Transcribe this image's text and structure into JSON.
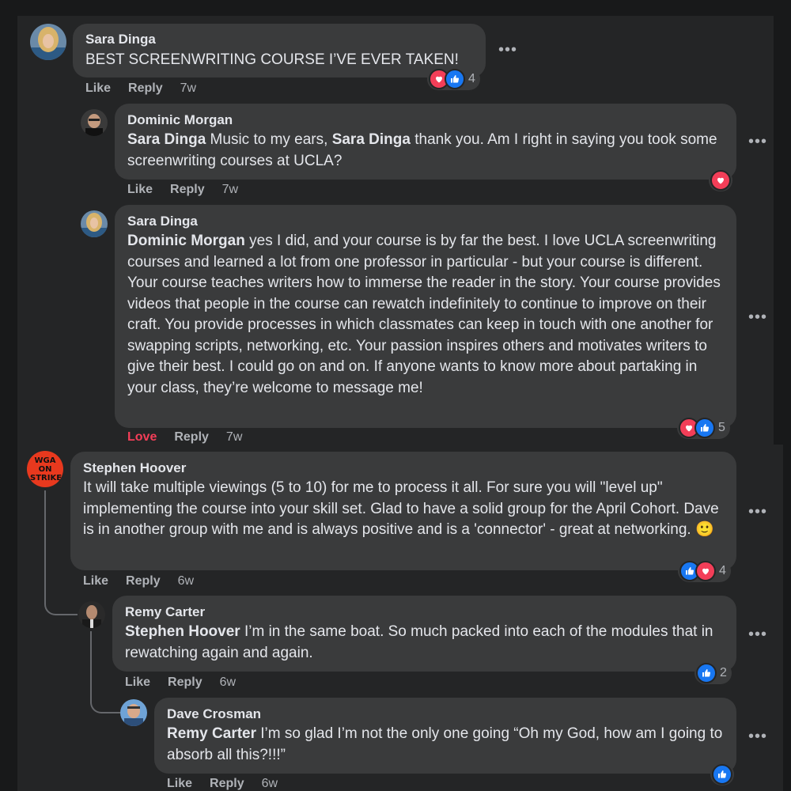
{
  "actions": {
    "like": "Like",
    "reply": "Reply",
    "love": "Love"
  },
  "comments": [
    {
      "author": "Sara Dinga",
      "text": "BEST SCREENWRITING COURSE I’VE EVER TAKEN!",
      "time": "7w",
      "reaction_count": "4"
    },
    {
      "author": "Dominic Morgan",
      "mention1": "Sara Dinga",
      "text_a": " Music to my ears, ",
      "mention2": "Sara Dinga",
      "text_b": " thank you. Am I right in saying you took some screenwriting courses at UCLA?",
      "time": "7w"
    },
    {
      "author": "Sara Dinga",
      "mention": "Dominic Morgan",
      "text": " yes I did, and your course is by far the best. I love UCLA screenwriting courses and learned a lot from one professor in particular - but your course is different. Your course teaches writers how to immerse the reader in the story. Your course provides videos that people in the course can rewatch indefinitely to continue to improve on their craft. You provide processes in which classmates can keep in touch with one another for swapping scripts, networking, etc. Your passion inspires others and motivates writers to give their best. I could go on and on. If anyone wants to know more about partaking in your class, they’re welcome to message me!",
      "time": "7w",
      "reaction_count": "5"
    },
    {
      "author": "Stephen Hoover",
      "avatar_text": "WGA ON STRIKE",
      "text": "It will take multiple viewings (5 to 10) for me to process it all. For sure you will \"level up\" implementing the course into your skill set. Glad to have a solid group for the April Cohort. Dave is in another group with me and is always positive and is a 'connector' - great at networking. 🙂",
      "time": "6w",
      "reaction_count": "4"
    },
    {
      "author": "Remy Carter",
      "mention": "Stephen Hoover",
      "text": " I’m in the same boat. So much packed into each of the modules that in rewatching again and again.",
      "time": "6w",
      "reaction_count": "2"
    },
    {
      "author": "Dave Crosman",
      "mention": "Remy Carter",
      "text": " I’m so glad I’m not the only one going “Oh my God, how am I going to absorb all this?!!!”",
      "time": "6w"
    }
  ],
  "colors": {
    "page_bg": "#18191a",
    "panel_bg": "#242526",
    "bubble_bg": "#3a3b3c",
    "text": "#e4e6eb",
    "muted": "#b0b3b8",
    "love": "#f33e58",
    "like": "#1877f2"
  }
}
